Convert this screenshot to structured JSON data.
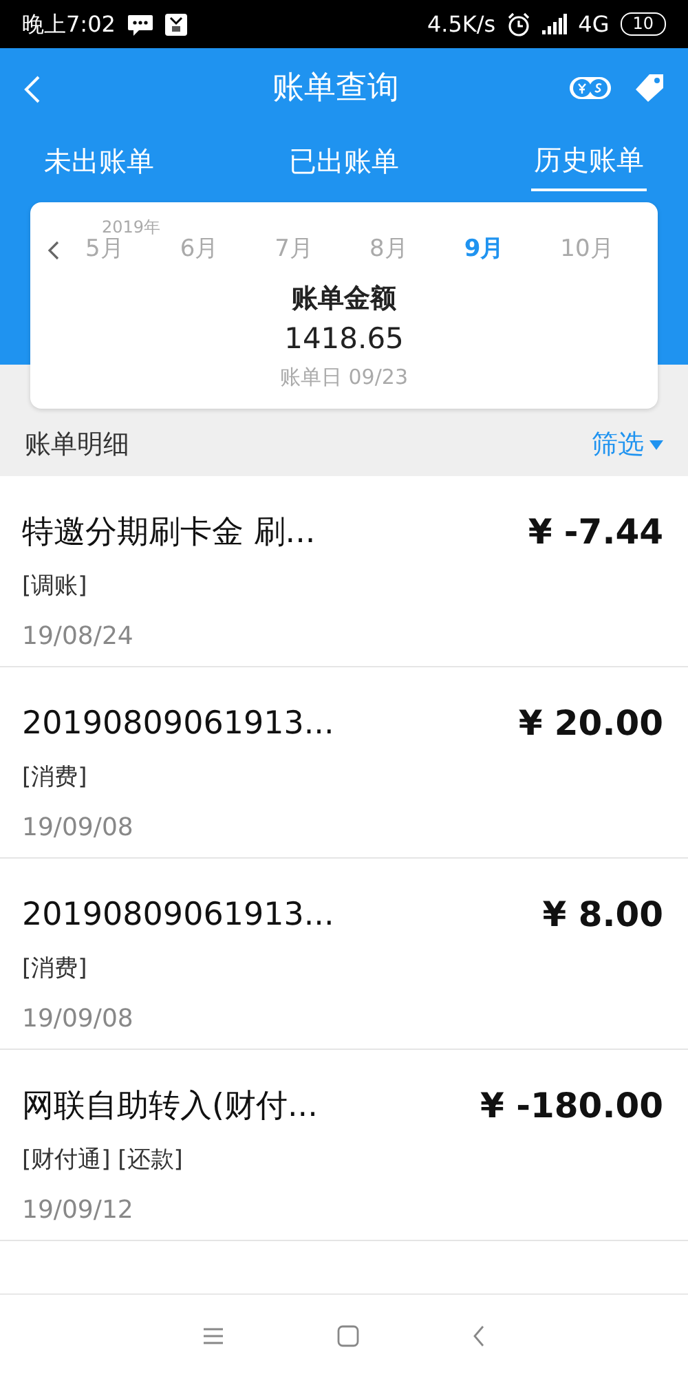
{
  "status_bar": {
    "time": "晚上7:02",
    "speed": "4.5K/s",
    "network": "4G",
    "battery": "10"
  },
  "header": {
    "title": "账单查询"
  },
  "tabs": [
    {
      "label": "未出账单",
      "selected": false
    },
    {
      "label": "已出账单",
      "selected": false
    },
    {
      "label": "历史账单",
      "selected": true
    }
  ],
  "bill_card": {
    "year": "2019年",
    "months": [
      {
        "label": "5月",
        "selected": false
      },
      {
        "label": "6月",
        "selected": false
      },
      {
        "label": "7月",
        "selected": false
      },
      {
        "label": "8月",
        "selected": false
      },
      {
        "label": "9月",
        "selected": true
      },
      {
        "label": "10月",
        "selected": false
      }
    ],
    "title": "账单金额",
    "amount": "1418.65",
    "bill_date": "账单日 09/23"
  },
  "details": {
    "title": "账单明细",
    "filter": "筛选"
  },
  "transactions": [
    {
      "title": "特邀分期刷卡金 刷...",
      "tags": "[调账]",
      "date": "19/08/24",
      "amount": "¥ -7.44"
    },
    {
      "title": "20190809061913...",
      "tags": "[消费]",
      "date": "19/09/08",
      "amount": "¥ 20.00"
    },
    {
      "title": "20190809061913...",
      "tags": "[消费]",
      "date": "19/09/08",
      "amount": "¥ 8.00"
    },
    {
      "title": "网联自助转入(财付...",
      "tags": "[财付通] [还款]",
      "date": "19/09/12",
      "amount": "¥ -180.00"
    }
  ]
}
